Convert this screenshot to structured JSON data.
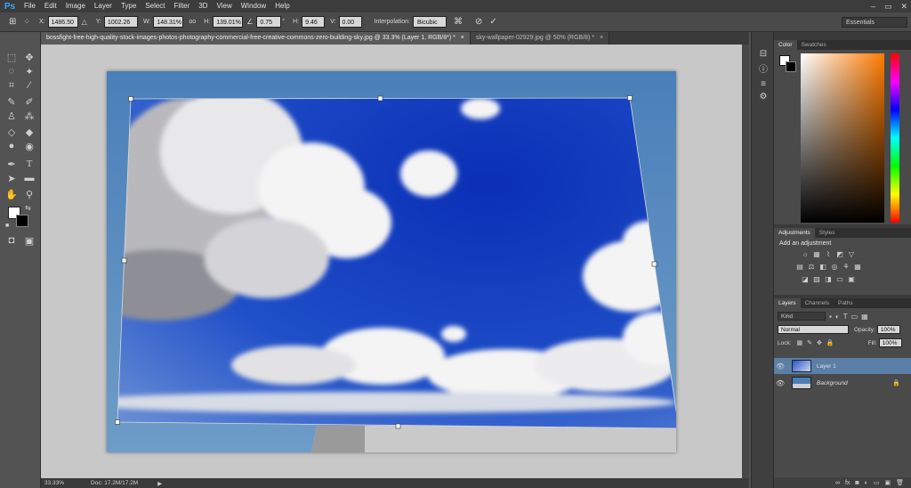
{
  "app": {
    "logo": "Ps"
  },
  "menu": [
    "File",
    "Edit",
    "Image",
    "Layer",
    "Type",
    "Select",
    "Filter",
    "3D",
    "View",
    "Window",
    "Help"
  ],
  "window_controls": [
    "–",
    "▭",
    "✕"
  ],
  "options": {
    "x_label": "X:",
    "x_value": "1486.50 p",
    "y_label": "Y:",
    "y_value": "1002.26 p",
    "w_label": "W:",
    "w_value": "148.31%",
    "link_label": "oo",
    "h_label": "H:",
    "h_value": "139.01%",
    "angle_value": "0.75",
    "angle_unit": "°",
    "hskew_label": "H:",
    "hskew_value": "9.46",
    "vskew_label": "V:",
    "vskew_value": "0.00",
    "interp_label": "Interpolation:",
    "interp_value": "Bicubic",
    "workspace": "Essentials"
  },
  "tabs": [
    {
      "label": "bossfight-free-high-quality-stock-images-photos-photography-commercial-free-creative-commons-zero-building-sky.jpg @ 33.3% (Layer 1, RGB/8*) *",
      "close": "×"
    },
    {
      "label": "sky-wallpaper-02929.jpg @ 50% (RGB/8) *",
      "close": "×"
    }
  ],
  "status": {
    "zoom": "33.33%",
    "doc": "Doc: 17.2M/17.2M",
    "arrow": "▶"
  },
  "color_panel": {
    "tabs": [
      "Color",
      "Swatches"
    ],
    "fg_color": "#ffffff",
    "bg_color": "#000000"
  },
  "adjustments_panel": {
    "tabs": [
      "Adjustments",
      "Styles"
    ],
    "title": "Add an adjustment"
  },
  "layers_panel": {
    "tabs": [
      "Layers",
      "Channels",
      "Paths"
    ],
    "kind_label": "Kind",
    "blend_mode": "Normal",
    "opacity_label": "Opacity:",
    "opacity_value": "100%",
    "lock_label": "Lock:",
    "fill_label": "Fill:",
    "fill_value": "100%",
    "layers": [
      {
        "name": "Layer 1",
        "selected": true
      },
      {
        "name": "Background",
        "selected": false,
        "italic": true
      }
    ]
  },
  "colors": {
    "selection": "#5b7fa6",
    "panel": "#4a4a4a",
    "canvas_bg": "#c8c8c8"
  }
}
